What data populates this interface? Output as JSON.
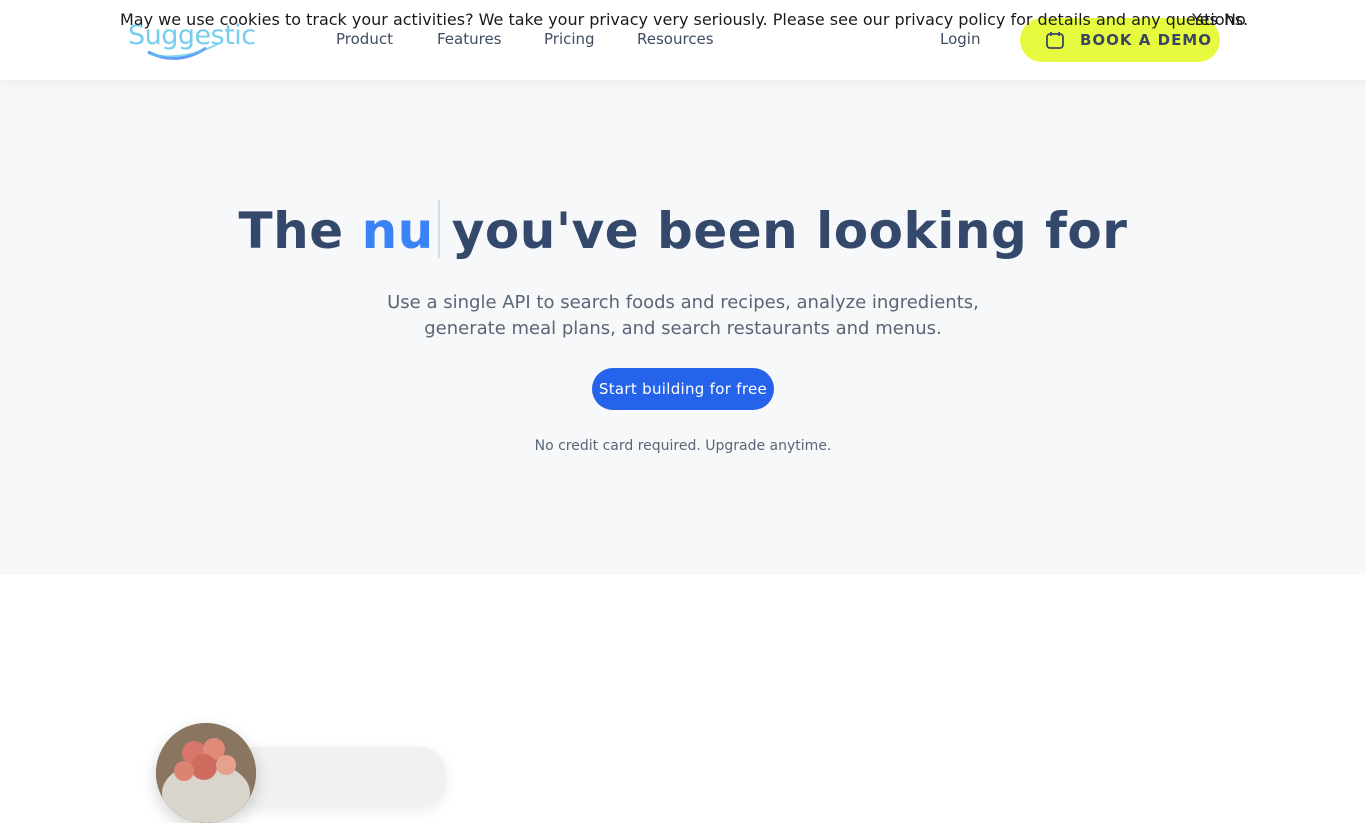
{
  "cookie_banner": {
    "text": "May we use cookies to track your activities? We take your privacy very seriously. Please see our privacy policy for details and any questions.",
    "yes_label": "Yes",
    "no_label": "No"
  },
  "header": {
    "logo_text": "Suggestic",
    "nav": [
      {
        "label": "Product"
      },
      {
        "label": "Features"
      },
      {
        "label": "Pricing"
      },
      {
        "label": "Resources"
      }
    ],
    "login_label": "Login",
    "demo_label": "BOOK A DEMO"
  },
  "hero": {
    "title_prefix": "The",
    "title_accent": "nu",
    "title_suffix": "you've been looking for",
    "subtitle": "Use a single API to search foods and recipes, analyze ingredients, generate meal plans, and search restaurants and menus.",
    "cta_label": "Start building for free",
    "note": "No credit card required. Upgrade anytime."
  },
  "colors": {
    "brand_blue": "#2563eb",
    "accent_blue": "#3b82f6",
    "demo_yellow": "#e6fa3f",
    "heading": "#33486a"
  }
}
